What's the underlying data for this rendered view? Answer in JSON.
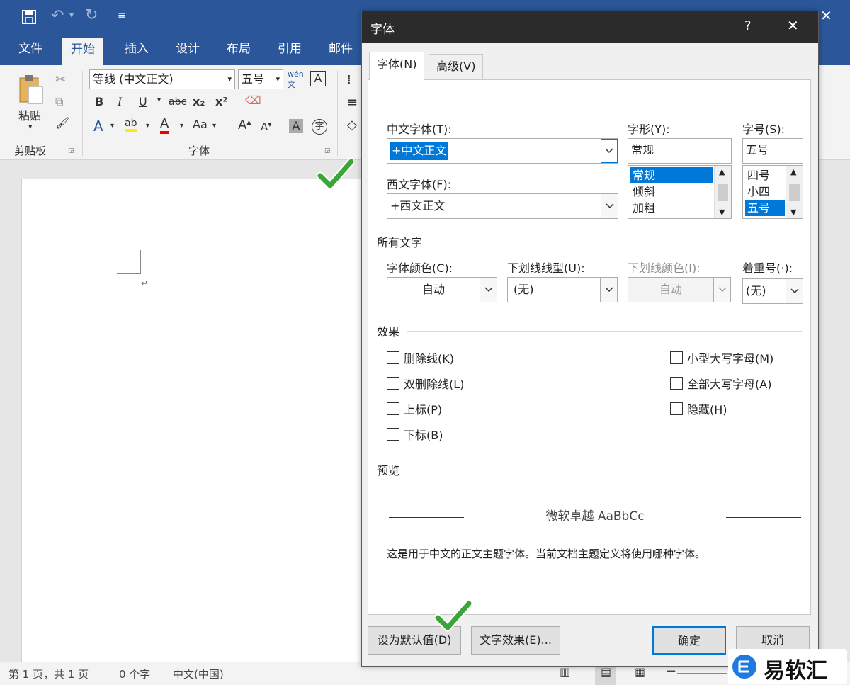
{
  "ribbon_tabs": [
    "文件",
    "开始",
    "插入",
    "设计",
    "布局",
    "引用",
    "邮件"
  ],
  "ribbon": {
    "paste_label": "粘贴",
    "clipboard_group": "剪贴板",
    "font_group": "字体",
    "font_name": "等线 (中文正文)",
    "font_size": "五号",
    "bold": "B",
    "italic": "I",
    "underline": "U",
    "strike": "abc",
    "subscript": "x₂",
    "superscript": "x²"
  },
  "statusbar": {
    "page": "第 1 页，共 1 页",
    "words": "0 个字",
    "lang": "中文(中国)"
  },
  "dialog": {
    "title": "字体",
    "help": "?",
    "close": "✕",
    "tabs": [
      "字体(N)",
      "高级(V)"
    ],
    "cn_font_label": "中文字体(T):",
    "cn_font_value": "+中文正文",
    "west_font_label": "西文字体(F):",
    "west_font_value": "+西文正文",
    "style_label": "字形(Y):",
    "style_value": "常规",
    "style_list": [
      "常规",
      "倾斜",
      "加粗"
    ],
    "size_label": "字号(S):",
    "size_value": "五号",
    "size_list": [
      "四号",
      "小四",
      "五号"
    ],
    "all_text_section": "所有文字",
    "color_label": "字体颜色(C):",
    "color_value": "自动",
    "underline_label": "下划线线型(U):",
    "underline_value": "(无)",
    "ucolor_label": "下划线颜色(I):",
    "ucolor_value": "自动",
    "emphasis_label": "着重号(·):",
    "emphasis_value": "(无)",
    "effects_section": "效果",
    "effects_left": [
      "删除线(K)",
      "双删除线(L)",
      "上标(P)",
      "下标(B)"
    ],
    "effects_right": [
      "小型大写字母(M)",
      "全部大写字母(A)",
      "隐藏(H)"
    ],
    "preview_section": "预览",
    "preview_text": "微软卓越  AaBbCc",
    "preview_note": "这是用于中文的正文主题字体。当前文档主题定义将使用哪种字体。",
    "btn_default": "设为默认值(D)",
    "btn_effects": "文字效果(E)...",
    "btn_ok": "确定",
    "btn_cancel": "取消"
  },
  "watermark": "易软汇",
  "colors": {
    "word_blue": "#2b579a",
    "select_blue": "#0078d7",
    "check_green": "#3aa639"
  }
}
